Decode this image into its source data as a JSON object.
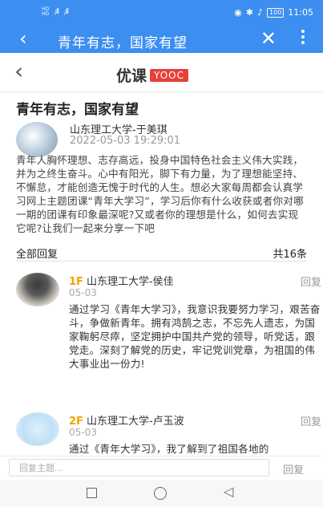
{
  "status_bar": {
    "time": "11:05",
    "battery": "100",
    "hd1": "HD",
    "hd2": "HD",
    "net1": "4G",
    "net2": "4G"
  },
  "title_bar": {
    "title": "青年有志，国家有望"
  },
  "app_header": {
    "logo_cn": "优课",
    "logo_en": "YOOC"
  },
  "post": {
    "title": "青年有志，国家有望",
    "author": "山东理工大学-于美琪",
    "time": "2022-05-03 19:29:01",
    "body": "青年人胸怀理想、志存高远，投身中国特色社会主义伟大实践，并为之终生奋斗。心中有阳光，脚下有力量，为了理想能坚持、不懈怠，才能创造无愧于时代的人生。想必大家每周都会认真学习网上主题团课“青年大学习”，学习后你有什么收获或者你对哪一期的团课有印象最深呢?又或者你的理想是什么，如何去实现它呢?让我们一起来分享一下吧"
  },
  "replies_header": {
    "all_label": "全部回复",
    "count": "共16条"
  },
  "replies": [
    {
      "floor": "1F",
      "name": "山东理工大学-侯佳",
      "date": "05-03",
      "action": "回复",
      "text": "通过学习《青年大学习》，我意识我要努力学习，艰苦奋斗，争做新青年。拥有鸿鹄之志，不忘先人遗志，为国家鞠躬尽瘁，坚定拥护中国共产党的领导，听党话，跟党走。深刻了解党的历史，牢记党训党章，为祖国的伟大事业出一份力!"
    },
    {
      "floor": "2F",
      "name": "山东理工大学-卢玉波",
      "date": "05-03",
      "action": "回复",
      "text": "通过《青年大学习》，我了解到了祖国各地的"
    }
  ],
  "bottom_bar": {
    "placeholder": "回复主题...",
    "send": "回复"
  }
}
